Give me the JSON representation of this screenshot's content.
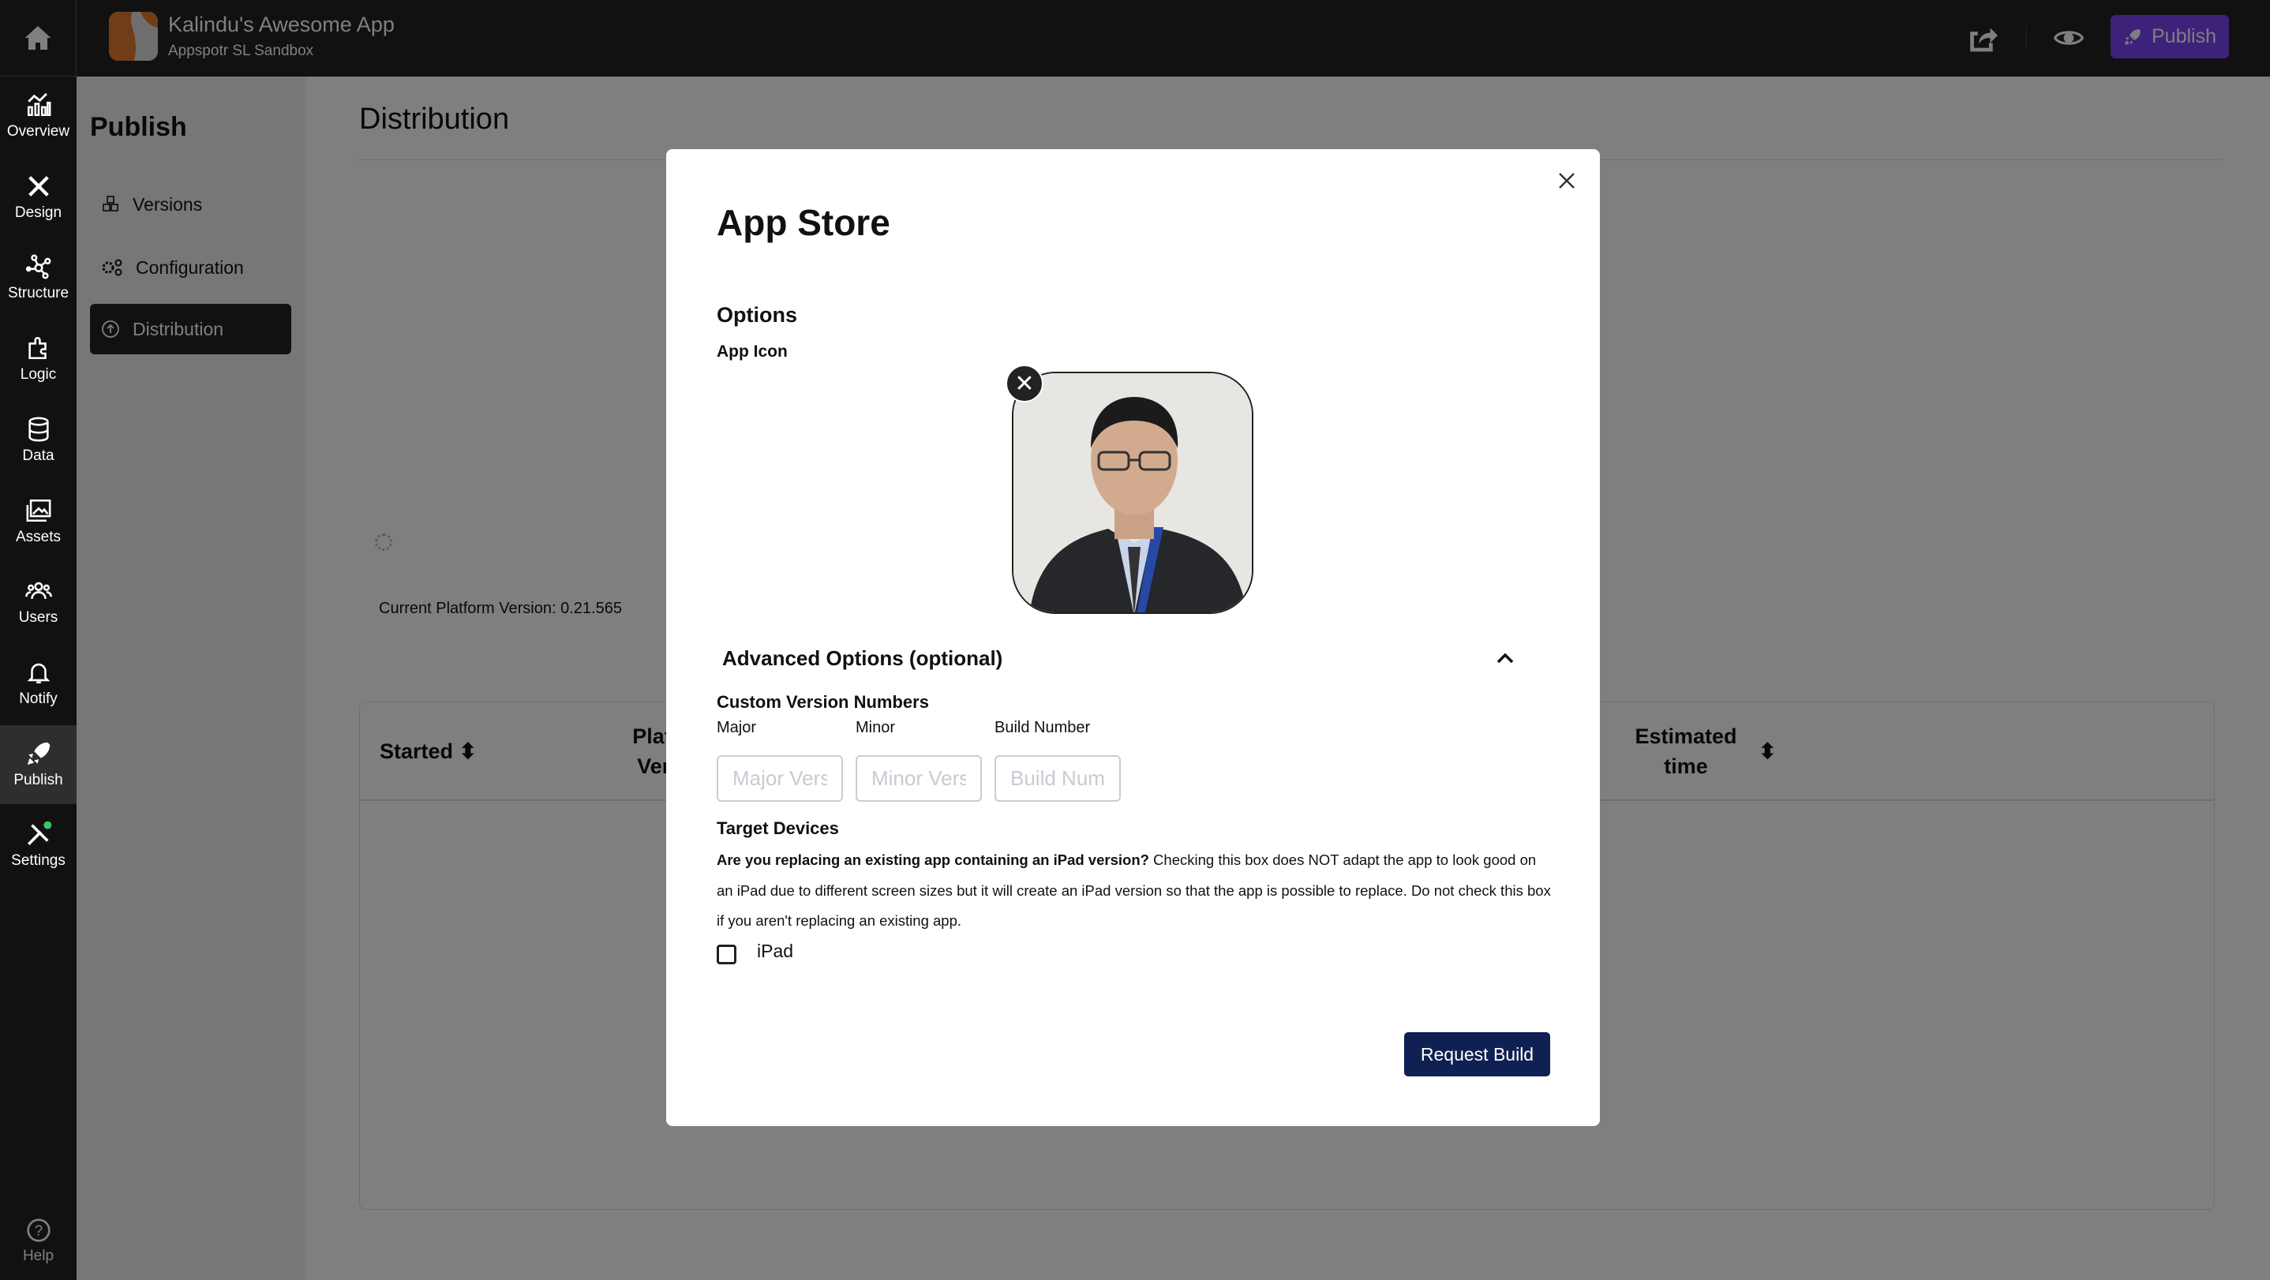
{
  "header": {
    "app_title": "Kalindu's Awesome App",
    "app_subtitle": "Appspotr SL Sandbox",
    "publish_label": "Publish",
    "accent": "#7a45f5"
  },
  "rail": {
    "items": [
      {
        "label": "Overview",
        "icon": "chart-icon"
      },
      {
        "label": "Design",
        "icon": "design-tools-icon"
      },
      {
        "label": "Structure",
        "icon": "structure-icon"
      },
      {
        "label": "Logic",
        "icon": "puzzle-icon"
      },
      {
        "label": "Data",
        "icon": "database-icon"
      },
      {
        "label": "Assets",
        "icon": "images-icon"
      },
      {
        "label": "Users",
        "icon": "users-icon"
      },
      {
        "label": "Notify",
        "icon": "bell-icon"
      },
      {
        "label": "Publish",
        "icon": "rocket-icon",
        "active": true
      },
      {
        "label": "Settings",
        "icon": "settings-icon"
      }
    ],
    "help": "Help"
  },
  "panel": {
    "title": "Publish",
    "items": [
      {
        "label": "Versions",
        "icon": "cubes-icon"
      },
      {
        "label": "Configuration",
        "icon": "gears-icon"
      },
      {
        "label": "Distribution",
        "icon": "upload-circle-icon",
        "active": true
      }
    ]
  },
  "main": {
    "title": "Distribution",
    "platform_version": "Current Platform Version: 0.21.565",
    "table": {
      "columns": [
        "Started",
        "Platform Version",
        "Estimated time"
      ]
    }
  },
  "modal": {
    "title": "App Store",
    "options": "Options",
    "app_icon": "App Icon",
    "advanced": "Advanced Options (optional)",
    "custom_versions": "Custom Version Numbers",
    "fields": [
      {
        "label": "Major",
        "placeholder": "Major Version"
      },
      {
        "label": "Minor",
        "placeholder": "Minor Version"
      },
      {
        "label": "Build Number",
        "placeholder": "Build Number"
      }
    ],
    "target_devices": "Target Devices",
    "question": "Are you replacing an existing app containing an iPad version?",
    "explanation": " Checking this box does NOT adapt the app to look good on an iPad due to different screen sizes but it will create an iPad version so that the app is possible to replace. Do not check this box if you aren't replacing an existing app.",
    "ipad_label": "iPad",
    "ipad_checked": false,
    "request_build": "Request Build",
    "button_color": "#0f2152"
  }
}
